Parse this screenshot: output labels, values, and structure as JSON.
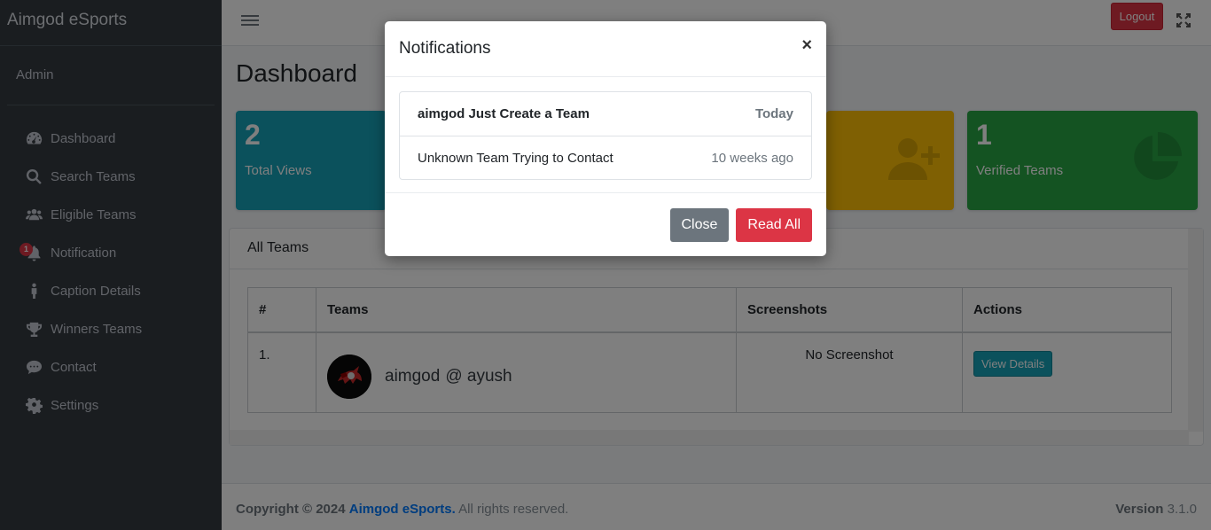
{
  "brand": "Aimgod eSports",
  "user": "Admin",
  "sidebar": {
    "items": [
      {
        "label": "Dashboard",
        "icon": "dashboard-icon"
      },
      {
        "label": "Search Teams",
        "icon": "search-icon"
      },
      {
        "label": "Eligible Teams",
        "icon": "users-icon"
      },
      {
        "label": "Notification",
        "icon": "bell-icon",
        "badge": "1"
      },
      {
        "label": "Caption Details",
        "icon": "person-icon"
      },
      {
        "label": "Winners Teams",
        "icon": "trophy-icon"
      },
      {
        "label": "Contact",
        "icon": "chat-icon"
      },
      {
        "label": "Settings",
        "icon": "gear-icon"
      }
    ]
  },
  "topbar": {
    "logout_label": "Logout"
  },
  "page_title": "Dashboard",
  "stats": [
    {
      "value": "2",
      "label": "Total Views",
      "color": "#17a2b8"
    },
    {
      "value": "",
      "label": "",
      "color": "#ffc107"
    },
    {
      "value": "1",
      "label": "Verified Teams",
      "color": "#28a745"
    }
  ],
  "teams_card": {
    "title": "All Teams",
    "columns": [
      "#",
      "Teams",
      "Screenshots",
      "Actions"
    ],
    "rows": [
      {
        "index": "1.",
        "team": "aimgod",
        "owner": "@ ayush",
        "screenshot": "No Screenshot",
        "action": "View Details"
      }
    ]
  },
  "footer": {
    "copyright": "Copyright © 2024",
    "brand_link": "Aimgod eSports.",
    "rights": "All rights reserved.",
    "version_label": "Version",
    "version": "3.1.0"
  },
  "modal": {
    "title": "Notifications",
    "close_symbol": "×",
    "items": [
      {
        "text": "aimgod Just Create a Team",
        "time": "Today",
        "unread": true
      },
      {
        "text": "Unknown Team Trying to Contact",
        "time": "10 weeks ago",
        "unread": false
      }
    ],
    "close_label": "Close",
    "read_all_label": "Read All"
  }
}
